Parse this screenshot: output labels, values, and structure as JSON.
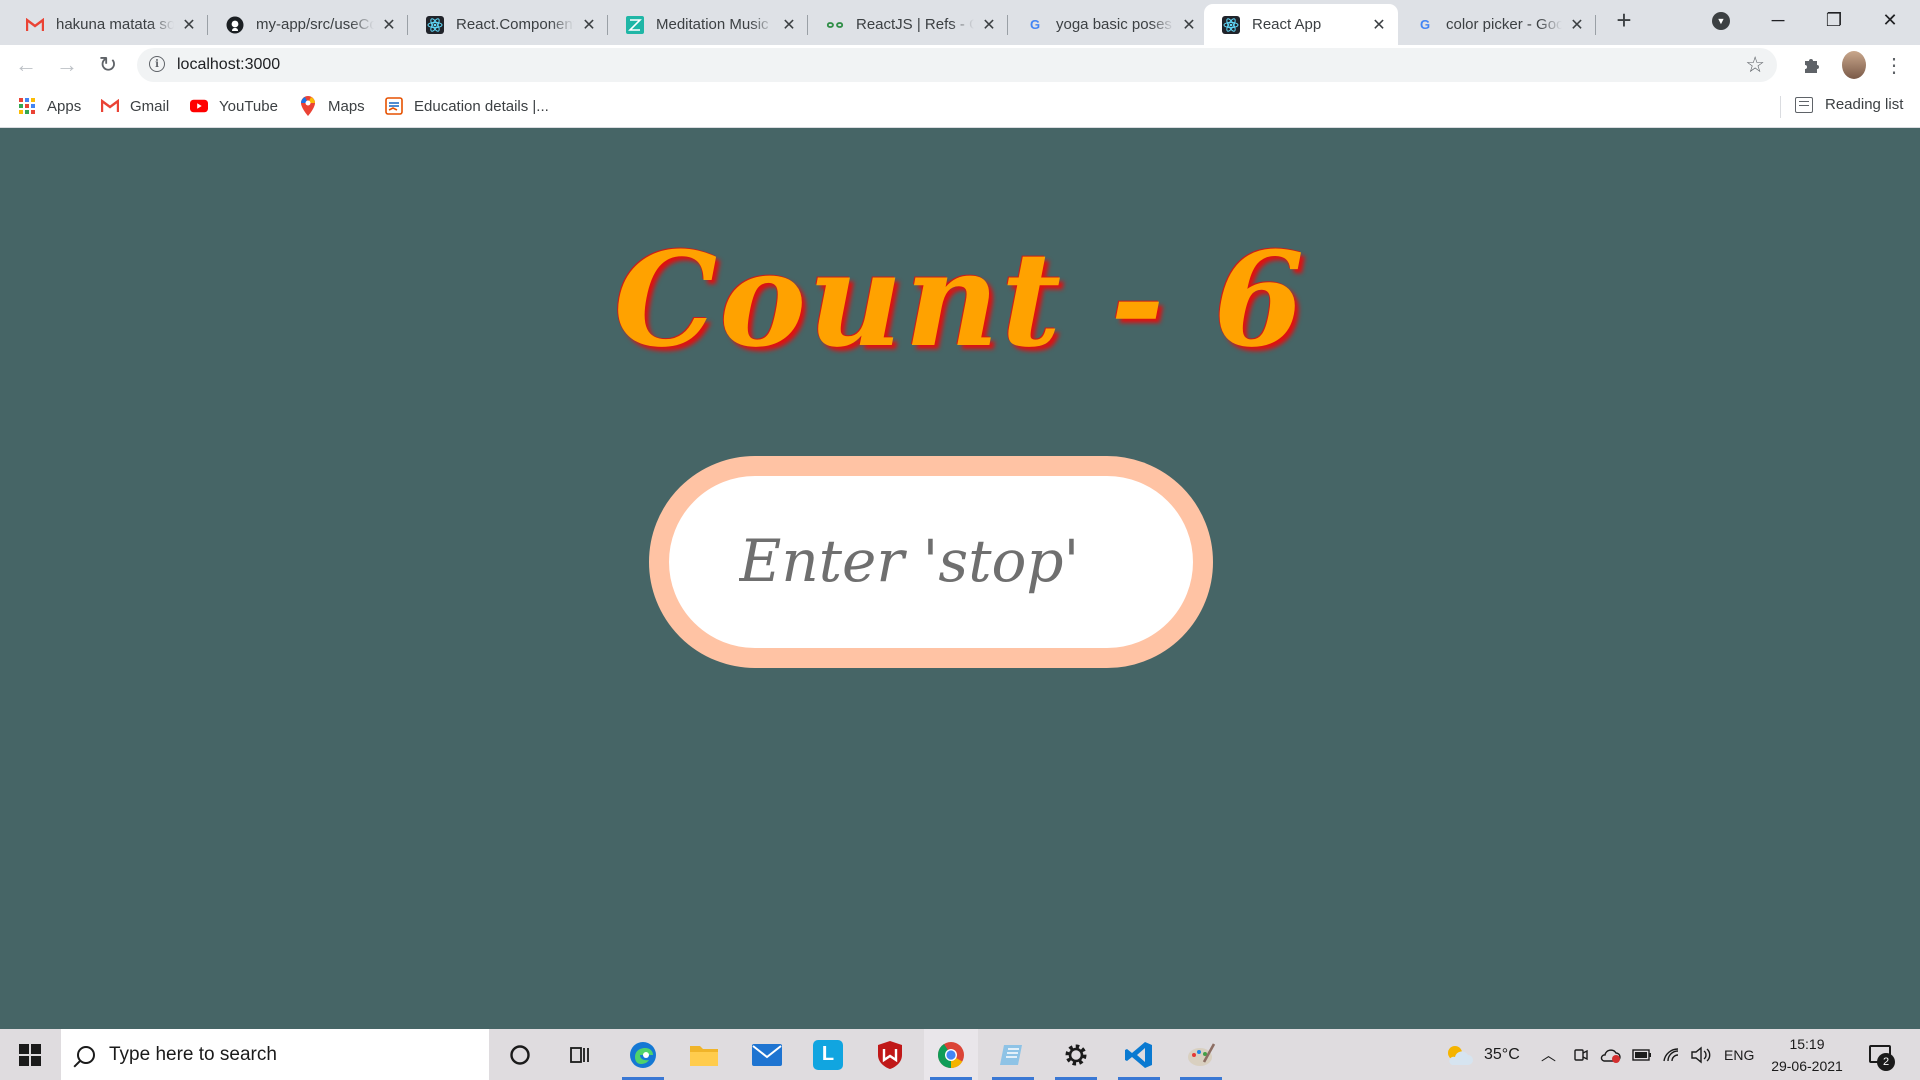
{
  "browser": {
    "tabs": [
      {
        "title": "hakuna matata so",
        "favicon": "gmail-icon"
      },
      {
        "title": "my-app/src/useCo",
        "favicon": "github-icon"
      },
      {
        "title": "React.Component",
        "favicon": "react-icon"
      },
      {
        "title": "Meditation Music",
        "favicon": "zen-icon"
      },
      {
        "title": "ReactJS | Refs - Ge",
        "favicon": "geeksforgeeks-icon"
      },
      {
        "title": "yoga basic poses",
        "favicon": "google-icon"
      },
      {
        "title": "React App",
        "favicon": "react-icon",
        "active": true
      },
      {
        "title": "color picker - Goo",
        "favicon": "google-icon"
      }
    ],
    "address_bar": {
      "url": "localhost:3000"
    },
    "bookmarks": [
      {
        "label": "Apps",
        "icon": "apps-grid-icon"
      },
      {
        "label": "Gmail",
        "icon": "gmail-icon"
      },
      {
        "label": "YouTube",
        "icon": "youtube-icon"
      },
      {
        "label": "Maps",
        "icon": "maps-icon"
      },
      {
        "label": "Education details |...",
        "icon": "education-icon"
      }
    ],
    "reading_list_label": "Reading list"
  },
  "page": {
    "heading": "Count - 6",
    "input": {
      "placeholder": "Enter 'stop'",
      "value": ""
    }
  },
  "taskbar": {
    "search_placeholder": "Type here to search",
    "weather": "35°C",
    "language": "ENG",
    "time": "15:19",
    "date": "29-06-2021",
    "notification_count": "2"
  },
  "colors": {
    "page_background": "#466566",
    "heading": "#ffa200",
    "heading_shadow": "#e01010",
    "input_border": "#ffc3a4"
  }
}
